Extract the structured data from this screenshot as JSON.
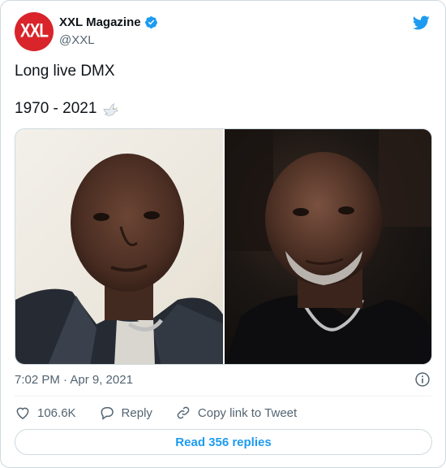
{
  "author": {
    "display_name": "XXL Magazine",
    "handle": "@XXL",
    "avatar_text": "XXL",
    "avatar_color": "#d8242a",
    "verified": true
  },
  "tweet": {
    "line1": "Long live DMX",
    "line2": "1970 - 2021",
    "emoji": "dove-emoji"
  },
  "media": {
    "count": 2
  },
  "meta": {
    "timestamp": "7:02 PM · Apr 9, 2021"
  },
  "actions": {
    "likes": "106.6K",
    "reply_label": "Reply",
    "copy_label": "Copy link to Tweet"
  },
  "read_replies_label": "Read 356 replies",
  "colors": {
    "accent": "#1d9bf0",
    "text": "#0f1419",
    "secondary": "#536471",
    "border": "#cfd9de"
  }
}
